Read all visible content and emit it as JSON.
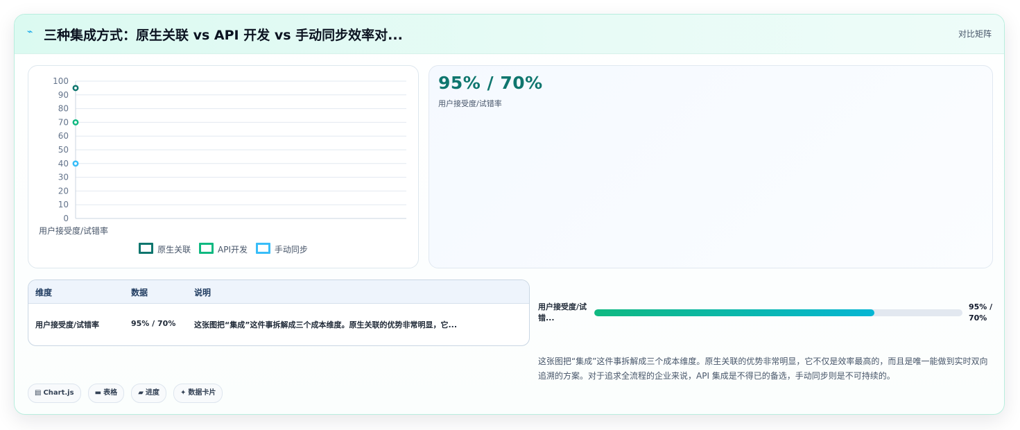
{
  "header": {
    "icon": "chart-line-icon",
    "title": "三种集成方式：原生关联 vs API 开发 vs 手动同步效率对...",
    "badge": "对比矩阵"
  },
  "chart_data": {
    "type": "scatter",
    "categories": [
      "用户接受度/试错率"
    ],
    "series": [
      {
        "name": "原生关联",
        "values": [
          95
        ],
        "color": "#0f766e"
      },
      {
        "name": "API开发",
        "values": [
          70
        ],
        "color": "#10b981"
      },
      {
        "name": "手动同步",
        "values": [
          40
        ],
        "color": "#38bdf8"
      }
    ],
    "ylim": [
      0,
      100
    ],
    "yticks": [
      "100",
      "90",
      "80",
      "70",
      "60",
      "50",
      "40",
      "30",
      "20",
      "10",
      "0"
    ],
    "xlabel": "",
    "ylabel": "",
    "grid": true,
    "legend": "bottom"
  },
  "kpi": {
    "value": "95% / 70%",
    "label": "用户接受度/试错率"
  },
  "table": {
    "headers": [
      "维度",
      "数据",
      "说明"
    ],
    "row": {
      "dimension": "用户接受度/试错率",
      "data": "95% / 70%",
      "note": "这张图把“集成”这件事拆解成三个成本维度。原生关联的优势非常明显，它..."
    }
  },
  "progress": {
    "label": "用户接受度/试错...",
    "fraction": 0.76,
    "value_text": "95% / 70%"
  },
  "description": "这张图把“集成”这件事拆解成三个成本维度。原生关联的优势非常明显，它不仅是效率最高的，而且是唯一能做到实时双向追溯的方案。对于追求全流程的企业来说，API 集成是不得已的备选，手动同步则是不可持续的。",
  "chips": [
    {
      "icon": "chart-icon",
      "glyph": "▤",
      "label": "Chart.js"
    },
    {
      "icon": "table-icon",
      "glyph": "▬",
      "label": "表格"
    },
    {
      "icon": "progress-icon",
      "glyph": "▰",
      "label": "进度"
    },
    {
      "icon": "sparkle-icon",
      "glyph": "✦",
      "label": "数据卡片"
    }
  ]
}
